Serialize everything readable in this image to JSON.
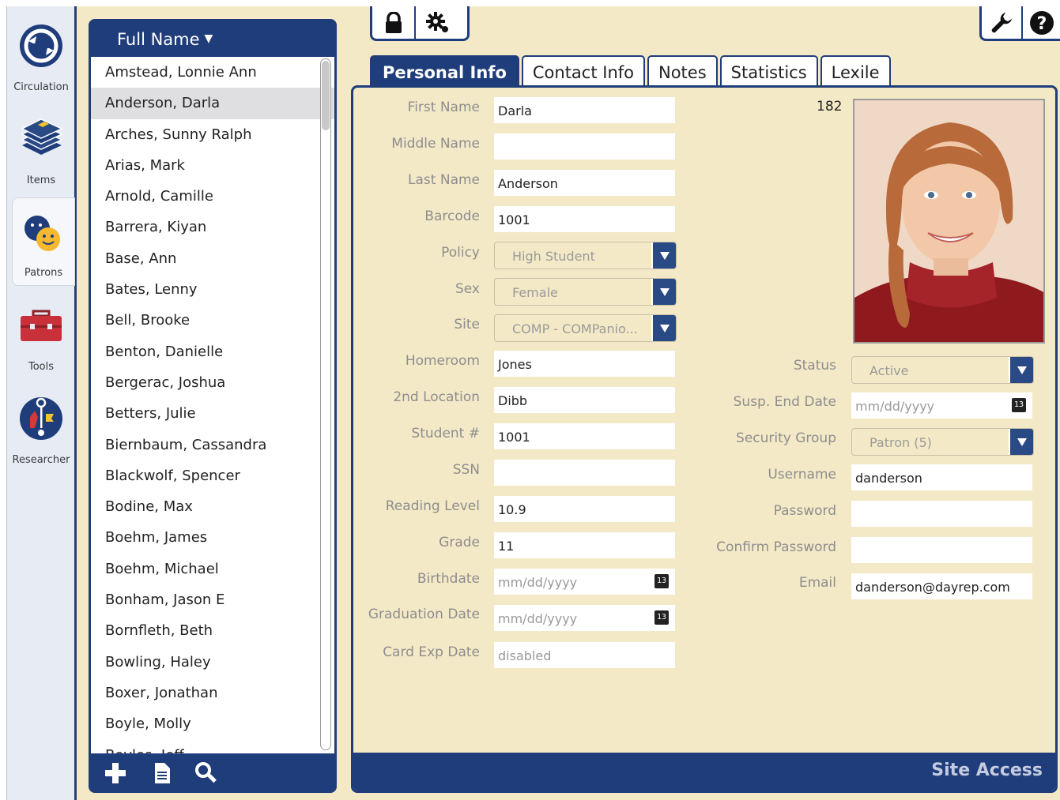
{
  "nav": {
    "items": [
      {
        "label": "Circulation",
        "icon": "circulation-icon"
      },
      {
        "label": "Items",
        "icon": "items-stack-icon"
      },
      {
        "label": "Patrons",
        "icon": "patrons-faces-icon"
      },
      {
        "label": "Tools",
        "icon": "toolbox-icon"
      },
      {
        "label": "Researcher",
        "icon": "researcher-icon"
      }
    ],
    "active": "Patrons"
  },
  "list": {
    "header": "Full Name",
    "items": [
      "Amstead, Lonnie Ann",
      "Anderson, Darla",
      "Arches, Sunny Ralph",
      "Arias, Mark",
      "Arnold, Camille",
      "Barrera, Kiyan",
      "Base, Ann",
      "Bates, Lenny",
      "Bell, Brooke",
      "Benton, Danielle",
      "Bergerac, Joshua",
      "Betters, Julie",
      "Biernbaum, Cassandra",
      "Blackwolf, Spencer",
      "Bodine, Max",
      "Boehm, James",
      "Boehm, Michael",
      "Bonham, Jason E",
      "Bornfleth, Beth",
      "Bowling, Haley",
      "Boxer, Jonathan",
      "Boyle, Molly",
      "Boyles, Jeff"
    ],
    "selected": "Anderson, Darla",
    "footer_icons": [
      "add-icon",
      "document-icon",
      "search-icon"
    ]
  },
  "toolbar": {
    "left_icons": [
      "lock-icon",
      "settings-gear-icon"
    ],
    "right_icons": [
      "wrench-icon",
      "help-icon"
    ]
  },
  "tabs": [
    "Personal Info",
    "Contact Info",
    "Notes",
    "Statistics",
    "Lexile"
  ],
  "active_tab": "Personal Info",
  "form": {
    "first_name": {
      "label": "First Name",
      "value": "Darla"
    },
    "middle_name": {
      "label": "Middle Name",
      "value": ""
    },
    "last_name": {
      "label": "Last Name",
      "value": "Anderson"
    },
    "barcode": {
      "label": "Barcode",
      "value": "1001"
    },
    "policy": {
      "label": "Policy",
      "value": "High Student"
    },
    "sex": {
      "label": "Sex",
      "value": "Female"
    },
    "site": {
      "label": "Site",
      "value": "COMP - COMPanio..."
    },
    "homeroom": {
      "label": "Homeroom",
      "value": "Jones"
    },
    "second_location": {
      "label": "2nd Location",
      "value": "Dibb"
    },
    "student_number": {
      "label": "Student #",
      "value": "1001"
    },
    "ssn": {
      "label": "SSN",
      "value": ""
    },
    "reading_level": {
      "label": "Reading Level",
      "value": "10.9"
    },
    "grade": {
      "label": "Grade",
      "value": "11"
    },
    "birthdate": {
      "label": "Birthdate",
      "placeholder": "mm/dd/yyyy"
    },
    "graduation_date": {
      "label": "Graduation Date",
      "placeholder": "mm/dd/yyyy"
    },
    "card_exp_date": {
      "label": "Card Exp Date",
      "value": "disabled"
    },
    "record_id": "182",
    "status": {
      "label": "Status",
      "value": "Active"
    },
    "susp_end_date": {
      "label": "Susp. End Date",
      "placeholder": "mm/dd/yyyy"
    },
    "security_group": {
      "label": "Security Group",
      "value": "Patron (5)"
    },
    "username": {
      "label": "Username",
      "value": "danderson"
    },
    "password": {
      "label": "Password",
      "value": ""
    },
    "confirm_password": {
      "label": "Confirm Password",
      "value": ""
    },
    "email": {
      "label": "Email",
      "value": "danderson@dayrep.com"
    },
    "calendar_icon_text": "13"
  },
  "footer": {
    "site_access": "Site Access"
  },
  "colors": {
    "navy": "#1f3d7b",
    "tan": "#f4e9c7",
    "rail": "#e7ebf4",
    "label_gray": "#8d8d8d"
  }
}
